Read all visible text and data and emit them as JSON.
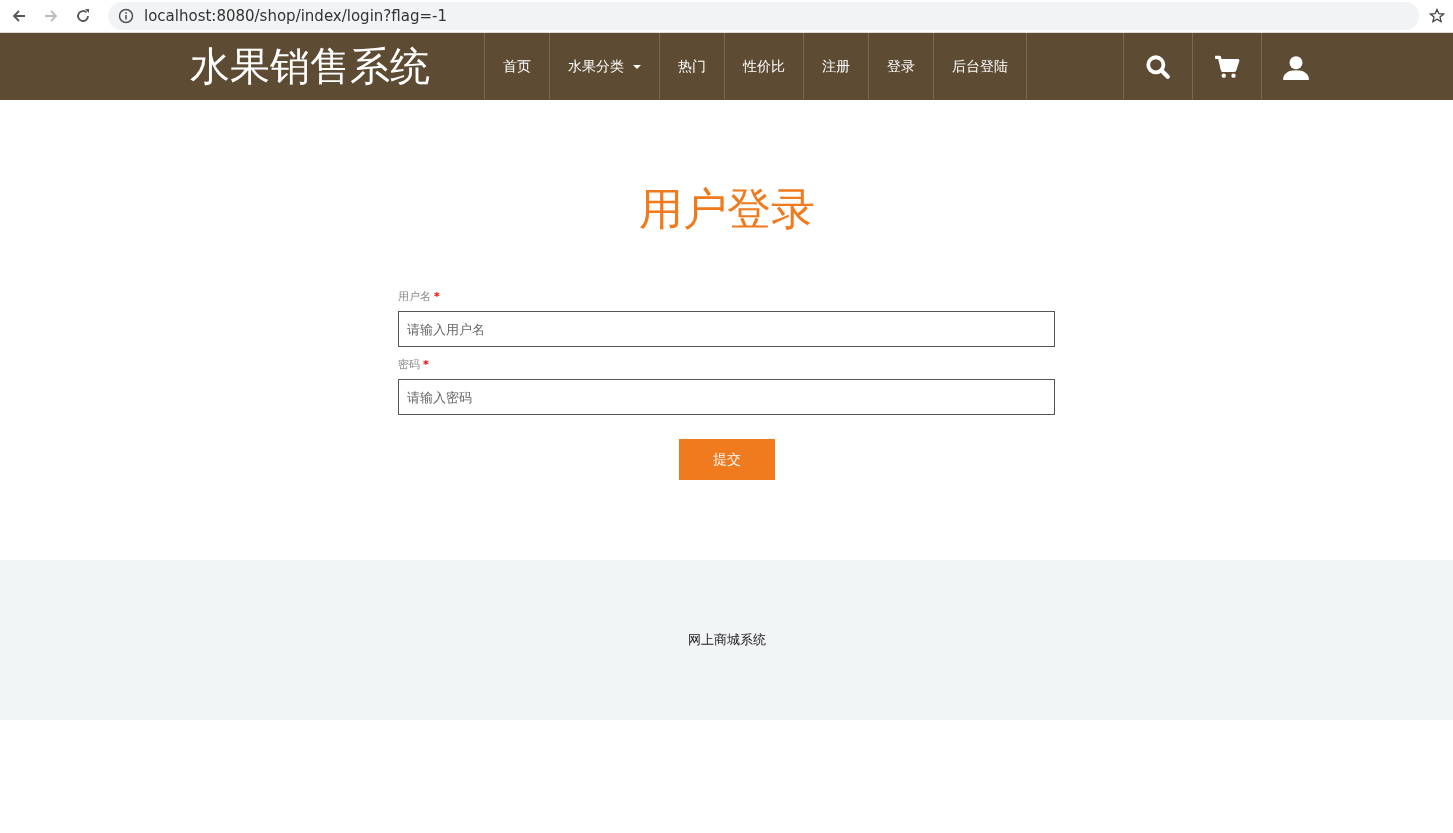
{
  "browser": {
    "nav_buttons": [
      {
        "kind": "back",
        "disabled": false
      },
      {
        "kind": "forward",
        "disabled": true
      },
      {
        "kind": "reload",
        "disabled": false
      }
    ],
    "url": "localhost:8080/shop/index/login?flag=-1"
  },
  "header": {
    "logo": "水果销售系统",
    "menu": [
      {
        "label": "首页",
        "dropdown": false
      },
      {
        "label": "水果分类",
        "dropdown": true
      },
      {
        "label": "热门",
        "dropdown": false
      },
      {
        "label": "性价比",
        "dropdown": false
      },
      {
        "label": "注册",
        "dropdown": false
      },
      {
        "label": "登录",
        "dropdown": false
      },
      {
        "label": "后台登陆",
        "dropdown": false
      }
    ],
    "actions": [
      {
        "kind": "search"
      },
      {
        "kind": "cart"
      },
      {
        "kind": "user"
      }
    ]
  },
  "login": {
    "title": "用户登录",
    "fields": [
      {
        "label": "用户名",
        "required_mark": "*",
        "placeholder": "请输入用户名"
      },
      {
        "label": "密码",
        "required_mark": "*",
        "placeholder": "请输入密码"
      }
    ],
    "submit": "提交"
  },
  "footer": {
    "text": "网上商城系统"
  }
}
